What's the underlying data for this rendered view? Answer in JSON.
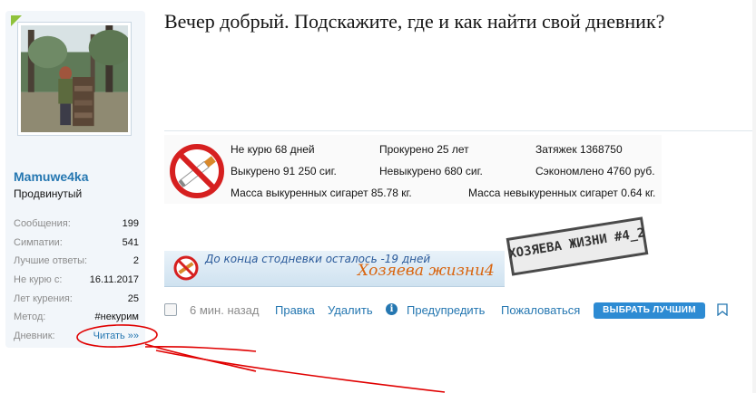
{
  "post": {
    "title": "Вечер добрый. Подскажите, где и как найти свой дневник?"
  },
  "author": {
    "username": "Mamuwe4ka",
    "user_title": "Продвинутый",
    "avatar_icon": "user-photo-avatar",
    "stats": [
      {
        "key": "Сообщения:",
        "value": "199"
      },
      {
        "key": "Симпатии:",
        "value": "541"
      },
      {
        "key": "Лучшие ответы:",
        "value": "2"
      },
      {
        "key": "Не курю с:",
        "value": "16.11.2017"
      },
      {
        "key": "Лет курения:",
        "value": "25"
      },
      {
        "key": "Метод:",
        "value": "#некурим"
      },
      {
        "key": "Дневник:",
        "value": "Читать »»"
      }
    ]
  },
  "signature": {
    "icon": "no-smoking-icon",
    "row1": [
      "Не курю 68 дней",
      "Прокурено 25 лет",
      "Затяжек 1368750"
    ],
    "row2": [
      "Выкурено 91 250 сиг.",
      "Невыкурено 680 сиг.",
      "Сэкономлено 4760 руб."
    ],
    "row3": [
      "Масса выкуренных сигарет 85.78 кг.",
      "Масса невыкуренных сигарет 0.64 кг."
    ],
    "banner_line1": "До конца стодневки осталось -19 дней",
    "banner_line2": "Хозяева жизни4",
    "stamp_text": "ХОЗЯЕВА ЖИЗНИ #4_2"
  },
  "actions": {
    "time": "6 мин. назад",
    "edit": "Правка",
    "delete": "Удалить",
    "warn": "Предупредить",
    "report": "Пожаловаться",
    "best": "ВЫБРАТЬ ЛУЧШИМ",
    "info_icon": "i"
  },
  "colors": {
    "link": "#2577b1",
    "username": "#2577b1",
    "best_button": "#2d8bd3",
    "annotation": "#e00000",
    "sidebar_bg": "#f2f6fa"
  }
}
